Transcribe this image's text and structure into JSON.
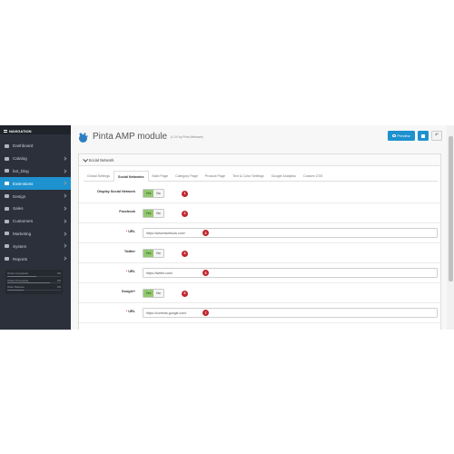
{
  "nav": {
    "title": "NAVIGATION"
  },
  "sidebar": {
    "items": [
      {
        "label": "Dashboard",
        "icon": "dashboard-icon",
        "active": false,
        "chevron": false
      },
      {
        "label": "Catalog",
        "icon": "tag-icon",
        "active": false,
        "chevron": true
      },
      {
        "label": "bot_blog",
        "icon": "blog-icon",
        "active": false,
        "chevron": true
      },
      {
        "label": "Extensions",
        "icon": "puzzle-icon",
        "active": true,
        "chevron": true
      },
      {
        "label": "Design",
        "icon": "monitor-icon",
        "active": false,
        "chevron": true
      },
      {
        "label": "Sales",
        "icon": "cart-icon",
        "active": false,
        "chevron": true
      },
      {
        "label": "Customers",
        "icon": "user-icon",
        "active": false,
        "chevron": true
      },
      {
        "label": "Marketing",
        "icon": "share-icon",
        "active": false,
        "chevron": true
      },
      {
        "label": "System",
        "icon": "cog-icon",
        "active": false,
        "chevron": true
      },
      {
        "label": "Reports",
        "icon": "chart-icon",
        "active": false,
        "chevron": true
      }
    ],
    "stats": [
      {
        "label": "Orders Completed",
        "value": "0%",
        "fraction": 0.55
      },
      {
        "label": "Orders Processing",
        "value": "0%",
        "fraction": 0.8
      },
      {
        "label": "Other Statuses",
        "value": "0%",
        "fraction": 0.3
      }
    ]
  },
  "header": {
    "title": "Pinta AMP module",
    "subtitle": "(1.0.0 by Pinta Webware)",
    "preview_label": "Preview"
  },
  "panel": {
    "heading": "Social Network",
    "tabs": [
      "Global Settings",
      "Social Networks",
      "Main Page",
      "Category Page",
      "Product Page",
      "Text & Color Settings",
      "Google Analytics",
      "Custom CSS"
    ],
    "active_tab": 1
  },
  "form": {
    "yes_label": "Yes",
    "no_label": "No",
    "rows": [
      {
        "type": "toggle",
        "label": "Display Social Network",
        "value": "Yes",
        "badge": "1"
      },
      {
        "type": "toggle",
        "label": "Facebook",
        "value": "Yes",
        "badge": "2"
      },
      {
        "type": "url",
        "label": "URL",
        "required": true,
        "value": "https://www.facebook.com/",
        "badge": "3"
      },
      {
        "type": "toggle",
        "label": "Twitter",
        "value": "Yes",
        "badge": "4"
      },
      {
        "type": "url",
        "label": "URL",
        "required": true,
        "value": "https://twitter.com/",
        "badge": "5"
      },
      {
        "type": "toggle",
        "label": "Google+",
        "value": "Yes",
        "badge": "6"
      },
      {
        "type": "url",
        "label": "URL",
        "required": true,
        "value": "https://currents.google.com/",
        "badge": "7"
      }
    ]
  },
  "colors": {
    "accent": "#1e91cf",
    "sidebar": "#2b303a",
    "toggle_on": "#91c86f",
    "badge": "#c0262d"
  }
}
